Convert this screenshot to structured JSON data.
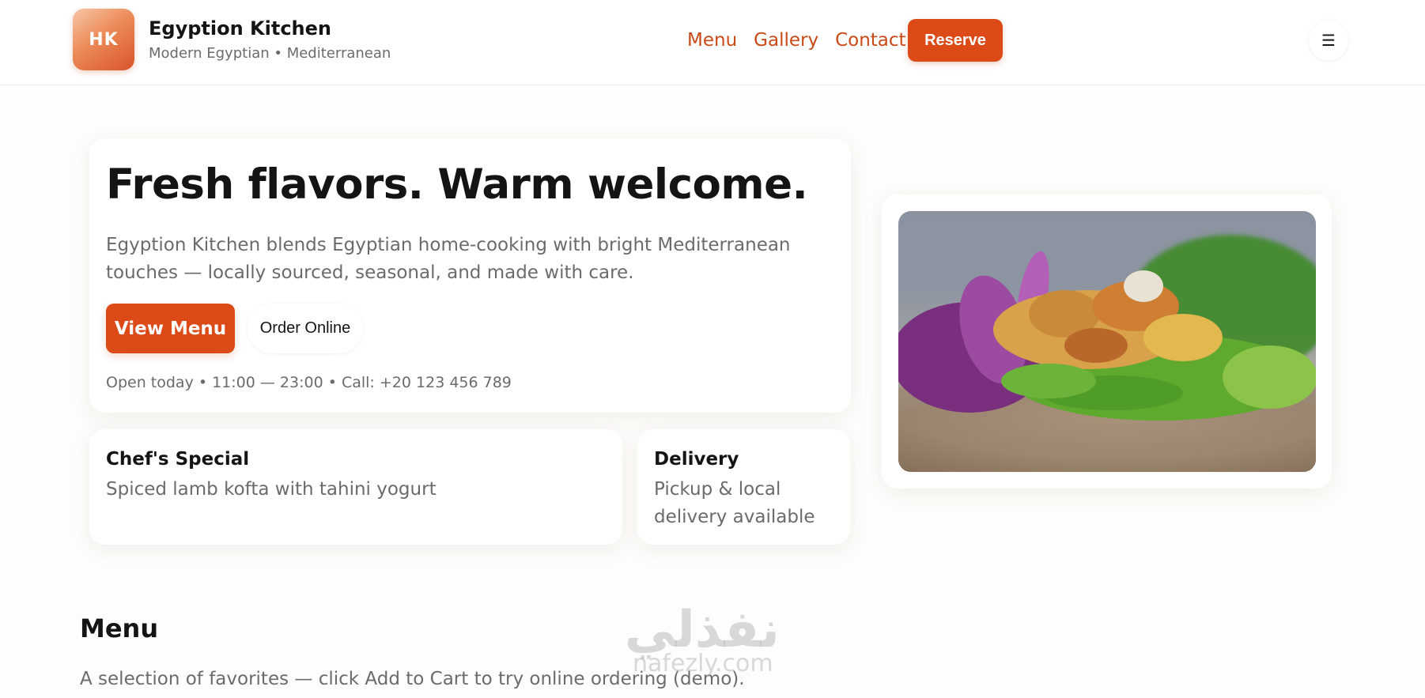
{
  "header": {
    "logo_text": "HK",
    "brand_name": "Egyption Kitchen",
    "tagline": "Modern Egyptian • Mediterranean",
    "nav": [
      {
        "label": "Menu"
      },
      {
        "label": "Gallery"
      },
      {
        "label": "Contact"
      }
    ],
    "reserve_label": "Reserve",
    "menu_toggle_glyph": "☰"
  },
  "hero": {
    "title": "Fresh flavors. Warm welcome.",
    "description": "Egyption Kitchen blends Egyptian home-cooking with bright Mediterranean touches — locally sourced, seasonal, and made with care.",
    "primary_button": "View Menu",
    "secondary_button": "Order Online",
    "hours": "Open today • 11:00 — 23:00 • Call: +20 123 456 789"
  },
  "features": {
    "special_title": "Chef's Special",
    "special_desc": "Spiced lamb kofta with tahini yogurt",
    "delivery_title": "Delivery",
    "delivery_desc": "Pickup & local delivery available"
  },
  "menu_section": {
    "heading": "Menu",
    "subtitle": "A selection of favorites — click Add to Cart to try online ordering (demo)."
  },
  "watermark": {
    "arabic": "نفذلي",
    "latin": "nafezly.com"
  },
  "colors": {
    "accent": "#db4a17",
    "nav_link": "#c94a17",
    "page_bg": "#fefdfb",
    "muted_text": "#6b6b6b"
  }
}
